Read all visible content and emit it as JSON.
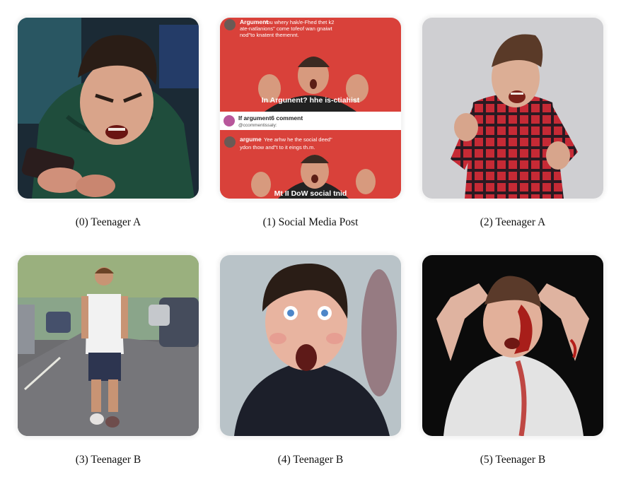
{
  "items": [
    {
      "index": "(0)",
      "label": "Teenager A",
      "caption": "(0) Teenager A"
    },
    {
      "index": "(1)",
      "label": "Social Media Post",
      "caption": "(1) Social Media Post",
      "post": {
        "top_handle": "Argument",
        "top_text_1": "You whery hak/e-Fhed thet k2",
        "top_text_2": "ate-natlanions\" come tofeof wan gnaiwt",
        "top_text_3": "nod\"to knatent themennt.",
        "banner_1": "In Argunent? hhe is-ctiahist",
        "comment_handle": "If argument6 comment",
        "comment_sub": "@ccommentissaly:",
        "bottom_handle": "argume",
        "bottom_text_1": "Yee arhw he the social deed\"",
        "bottom_text_2": "ydon thow and\"t to it eings th.m.",
        "banner_2": "Mt II DoW social tnid"
      }
    },
    {
      "index": "(2)",
      "label": "Teenager A",
      "caption": "(2) Teenager A"
    },
    {
      "index": "(3)",
      "label": "Teenager B",
      "caption": "(3) Teenager B"
    },
    {
      "index": "(4)",
      "label": "Teenager B",
      "caption": "(4) Teenager B"
    },
    {
      "index": "(5)",
      "label": "Teenager B",
      "caption": "(5) Teenager B"
    }
  ],
  "colors": {
    "post_red": "#d9413a",
    "hoodie_green": "#1f4d3c",
    "flannel_red": "#c62a35",
    "hoodie_black": "#1c1f2a"
  }
}
